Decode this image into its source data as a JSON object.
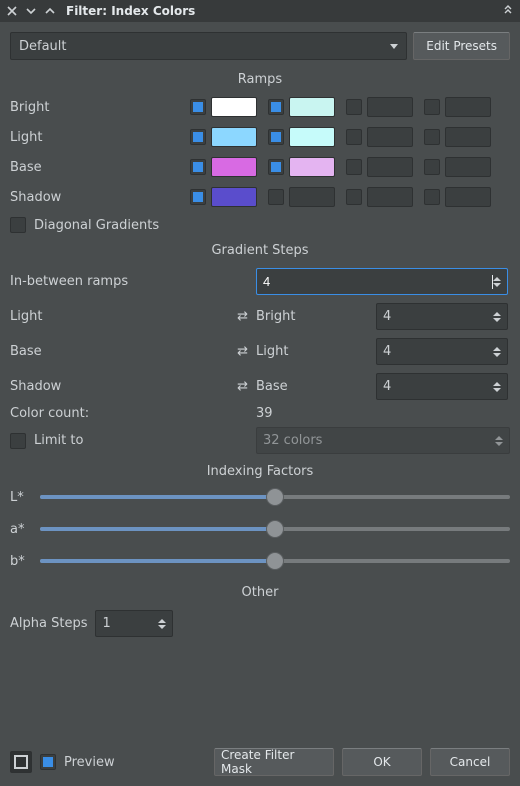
{
  "titlebar": {
    "title": "Filter: Index Colors"
  },
  "preset": {
    "combo_value": "Default",
    "edit_button": "Edit Presets"
  },
  "sections": {
    "ramps": "Ramps",
    "gradient_steps": "Gradient Steps",
    "indexing_factors": "Indexing Factors",
    "other": "Other"
  },
  "ramps": {
    "labels": [
      "Bright",
      "Light",
      "Base",
      "Shadow"
    ],
    "rows": [
      {
        "label": "Bright",
        "cells": [
          {
            "on": true,
            "color": "#ffffff"
          },
          {
            "on": true,
            "color": "#c9f5f1"
          },
          {
            "on": false,
            "color": "#3b3f40"
          },
          {
            "on": false,
            "color": "#3b3f40"
          }
        ]
      },
      {
        "label": "Light",
        "cells": [
          {
            "on": true,
            "color": "#8cd7ff"
          },
          {
            "on": true,
            "color": "#c6fbfa"
          },
          {
            "on": false,
            "color": "#3b3f40"
          },
          {
            "on": false,
            "color": "#3b3f40"
          }
        ]
      },
      {
        "label": "Base",
        "cells": [
          {
            "on": true,
            "color": "#d86ae3"
          },
          {
            "on": true,
            "color": "#e4b4f1"
          },
          {
            "on": false,
            "color": "#3b3f40"
          },
          {
            "on": false,
            "color": "#3b3f40"
          }
        ]
      },
      {
        "label": "Shadow",
        "cells": [
          {
            "on": true,
            "color": "#5a4dcc"
          },
          {
            "on": false,
            "color": "#3b3f40"
          },
          {
            "on": false,
            "color": "#3b3f40"
          },
          {
            "on": false,
            "color": "#3b3f40"
          }
        ]
      }
    ],
    "diagonal_label": "Diagonal Gradients",
    "diagonal_on": false
  },
  "gradient_steps": {
    "in_between_label": "In-between ramps",
    "in_between_value": "4",
    "left_labels": [
      "Light",
      "Base",
      "Shadow"
    ],
    "right": [
      {
        "label": "Bright",
        "value": "4"
      },
      {
        "label": "Light",
        "value": "4"
      },
      {
        "label": "Base",
        "value": "4"
      }
    ]
  },
  "color_count": {
    "label": "Color count:",
    "value": "39"
  },
  "limit": {
    "on": false,
    "label": "Limit to",
    "combo_value": "32 colors"
  },
  "indexing_factors": {
    "sliders": [
      {
        "label": "L*",
        "pct": 50
      },
      {
        "label": "a*",
        "pct": 50
      },
      {
        "label": "b*",
        "pct": 50
      }
    ]
  },
  "other": {
    "alpha_label": "Alpha Steps",
    "alpha_value": "1"
  },
  "footer": {
    "preview_label": "Preview",
    "preview_on": true,
    "create_mask": "Create Filter Mask",
    "ok": "OK",
    "cancel": "Cancel"
  }
}
